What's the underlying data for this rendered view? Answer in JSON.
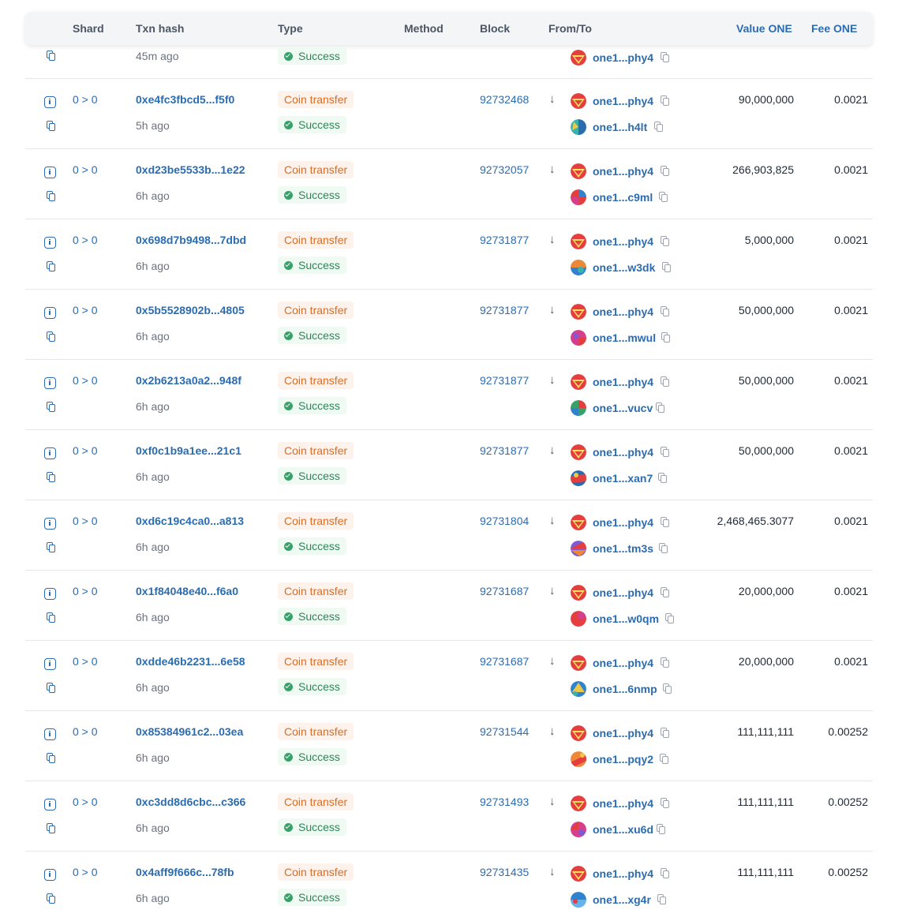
{
  "header": {
    "shard": "Shard",
    "txn_hash": "Txn hash",
    "type": "Type",
    "method": "Method",
    "block": "Block",
    "from_to": "From/To",
    "value": "Value ONE",
    "fee": "Fee ONE"
  },
  "first_row": {
    "age": "45m ago",
    "status": "Success",
    "to": "one1...phy4"
  },
  "rows": [
    {
      "shard": "0 > 0",
      "hash": "0xe4fc3fbcd5...f5f0",
      "age": "5h ago",
      "type": "Coin transfer",
      "status": "Success",
      "block": "92732468",
      "from": "one1...phy4",
      "to": "one1...h4lt",
      "value": "90,000,000",
      "fee": "0.0021"
    },
    {
      "shard": "0 > 0",
      "hash": "0xd23be5533b...1e22",
      "age": "6h ago",
      "type": "Coin transfer",
      "status": "Success",
      "block": "92732057",
      "from": "one1...phy4",
      "to": "one1...c9ml",
      "value": "266,903,825",
      "fee": "0.0021"
    },
    {
      "shard": "0 > 0",
      "hash": "0x698d7b9498...7dbd",
      "age": "6h ago",
      "type": "Coin transfer",
      "status": "Success",
      "block": "92731877",
      "from": "one1...phy4",
      "to": "one1...w3dk",
      "value": "5,000,000",
      "fee": "0.0021"
    },
    {
      "shard": "0 > 0",
      "hash": "0x5b5528902b...4805",
      "age": "6h ago",
      "type": "Coin transfer",
      "status": "Success",
      "block": "92731877",
      "from": "one1...phy4",
      "to": "one1...mwul",
      "value": "50,000,000",
      "fee": "0.0021"
    },
    {
      "shard": "0 > 0",
      "hash": "0x2b6213a0a2...948f",
      "age": "6h ago",
      "type": "Coin transfer",
      "status": "Success",
      "block": "92731877",
      "from": "one1...phy4",
      "to": "one1...vucv",
      "value": "50,000,000",
      "fee": "0.0021"
    },
    {
      "shard": "0 > 0",
      "hash": "0xf0c1b9a1ee...21c1",
      "age": "6h ago",
      "type": "Coin transfer",
      "status": "Success",
      "block": "92731877",
      "from": "one1...phy4",
      "to": "one1...xan7",
      "value": "50,000,000",
      "fee": "0.0021"
    },
    {
      "shard": "0 > 0",
      "hash": "0xd6c19c4ca0...a813",
      "age": "6h ago",
      "type": "Coin transfer",
      "status": "Success",
      "block": "92731804",
      "from": "one1...phy4",
      "to": "one1...tm3s",
      "value": "2,468,465.3077",
      "fee": "0.0021"
    },
    {
      "shard": "0 > 0",
      "hash": "0x1f84048e40...f6a0",
      "age": "6h ago",
      "type": "Coin transfer",
      "status": "Success",
      "block": "92731687",
      "from": "one1...phy4",
      "to": "one1...w0qm",
      "value": "20,000,000",
      "fee": "0.0021"
    },
    {
      "shard": "0 > 0",
      "hash": "0xdde46b2231...6e58",
      "age": "6h ago",
      "type": "Coin transfer",
      "status": "Success",
      "block": "92731687",
      "from": "one1...phy4",
      "to": "one1...6nmp",
      "value": "20,000,000",
      "fee": "0.0021"
    },
    {
      "shard": "0 > 0",
      "hash": "0x85384961c2...03ea",
      "age": "6h ago",
      "type": "Coin transfer",
      "status": "Success",
      "block": "92731544",
      "from": "one1...phy4",
      "to": "one1...pqy2",
      "value": "111,111,111",
      "fee": "0.00252"
    },
    {
      "shard": "0 > 0",
      "hash": "0xc3dd8d6cbc...c366",
      "age": "6h ago",
      "type": "Coin transfer",
      "status": "Success",
      "block": "92731493",
      "from": "one1...phy4",
      "to": "one1...xu6d",
      "value": "111,111,111",
      "fee": "0.00252"
    },
    {
      "shard": "0 > 0",
      "hash": "0x4aff9f666c...78fb",
      "age": "6h ago",
      "type": "Coin transfer",
      "status": "Success",
      "block": "92731435",
      "from": "one1...phy4",
      "to": "one1...xg4r",
      "value": "111,111,111",
      "fee": "0.00252"
    }
  ],
  "icons": {
    "info": "info-icon",
    "copy": "copy-icon",
    "success": "check-circle-icon",
    "direction": "arrow-down-icon"
  },
  "colors": {
    "link": "#2b6cb0",
    "type_badge_bg": "#fef3ec",
    "type_badge_text": "#dd6b20",
    "success_bg": "#effaf3",
    "success_text": "#2f855a"
  }
}
